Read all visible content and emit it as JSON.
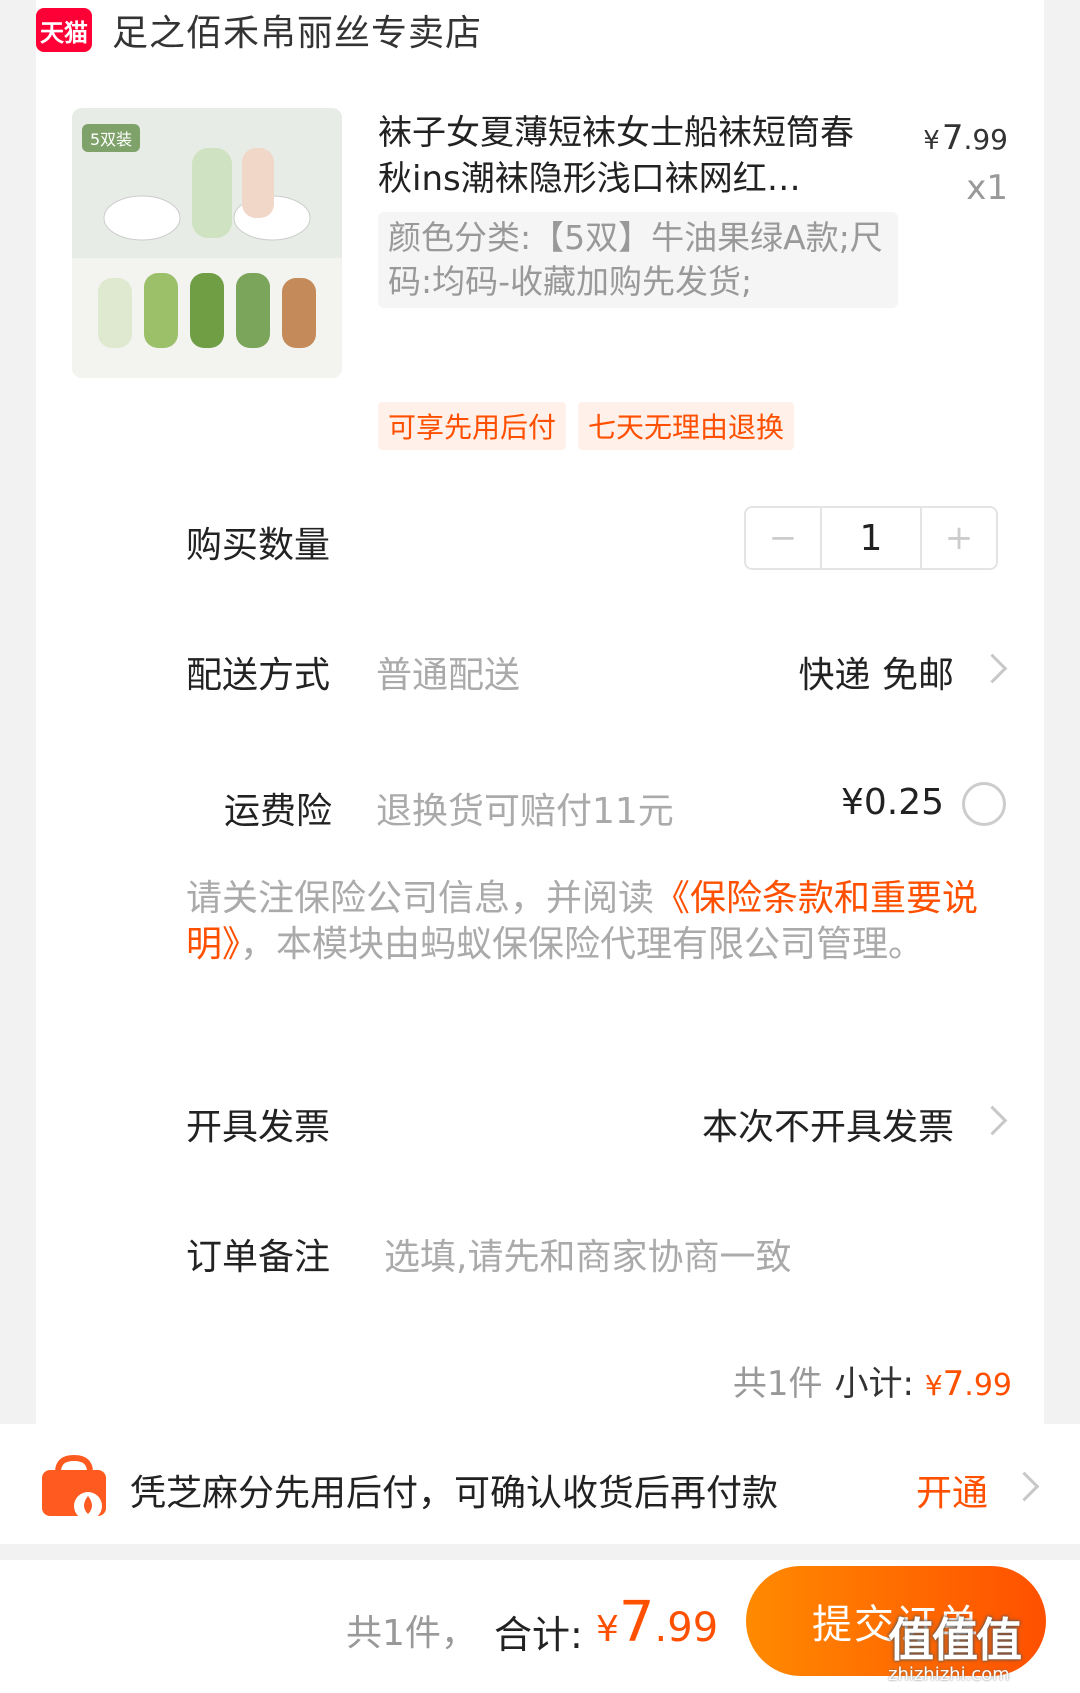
{
  "shop": {
    "logo_text": "天猫",
    "name": "足之佰禾帛丽丝专卖店"
  },
  "product": {
    "image_badge": "5双装",
    "title": "袜子女夏薄短袜女士船袜短筒春秋ins潮袜隐形浅口袜网红…",
    "price_symbol": "¥",
    "price_int": "7",
    "price_dec": ".99",
    "qty": "x1",
    "sku": "颜色分类:【5双】牛油果绿A款;尺码:均码-收藏加购先发货;",
    "tags": [
      "可享先用后付",
      "七天无理由退换"
    ]
  },
  "quantity": {
    "label": "购买数量",
    "value": "1",
    "minus": "−",
    "plus": "+"
  },
  "delivery": {
    "label": "配送方式",
    "sub": "普通配送",
    "value": "快递 免邮"
  },
  "insurance": {
    "label": "运费险",
    "sub": "退换货可赔付11元",
    "value": "¥0.25"
  },
  "notice": {
    "prefix": "请关注保险公司信息，并阅读",
    "link": "《保险条款和重要说明》",
    "suffix": "，本模块由蚂蚁保保险代理有限公司管理。"
  },
  "invoice": {
    "label": "开具发票",
    "value": "本次不开具发票"
  },
  "remark": {
    "label": "订单备注",
    "placeholder": "选填,请先和商家协商一致"
  },
  "subtotal": {
    "count": "共1件",
    "label": "小计:",
    "yen": "¥",
    "int": "7",
    "dec": ".99"
  },
  "promo": {
    "text": "凭芝麻分先用后付，可确认收货后再付款",
    "link": "开通"
  },
  "footer": {
    "count": "共1件，",
    "total_label": "合计:",
    "yen": "¥",
    "int": "7",
    "dec": ".99",
    "submit": "提交订单"
  },
  "watermark": {
    "big": "值值值",
    "small": "zhizhizhi.com"
  },
  "colors": {
    "accent": "#ff5000",
    "tmall": "#ff0036"
  }
}
